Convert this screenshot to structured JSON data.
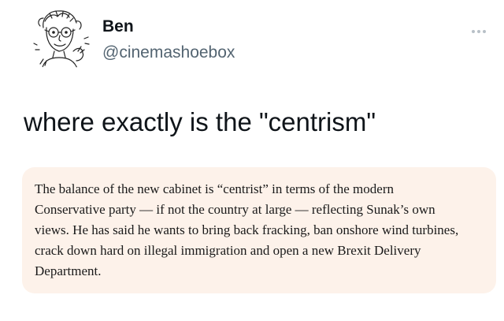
{
  "header": {
    "display_name": "Ben",
    "handle": "@cinemashoebox",
    "avatar_icon": "cartoon-sketch-avatar",
    "more_icon": "more-horizontal-icon"
  },
  "tweet": {
    "text": "where exactly is the \"centrism\""
  },
  "quote": {
    "lines": [
      "The balance of the new cabinet is “centrist” in terms of the modern",
      "Conservative party — if not the country at large — reflecting Sunak’s own",
      "views. He has said he wants to bring back fracking, ban onshore wind turbines,",
      "crack down hard on illegal immigration and open a new Brexit Delivery",
      "Department."
    ],
    "background_color": "#fdf2ea"
  },
  "colors": {
    "text": "#0f1419",
    "secondary_text": "#536471"
  }
}
